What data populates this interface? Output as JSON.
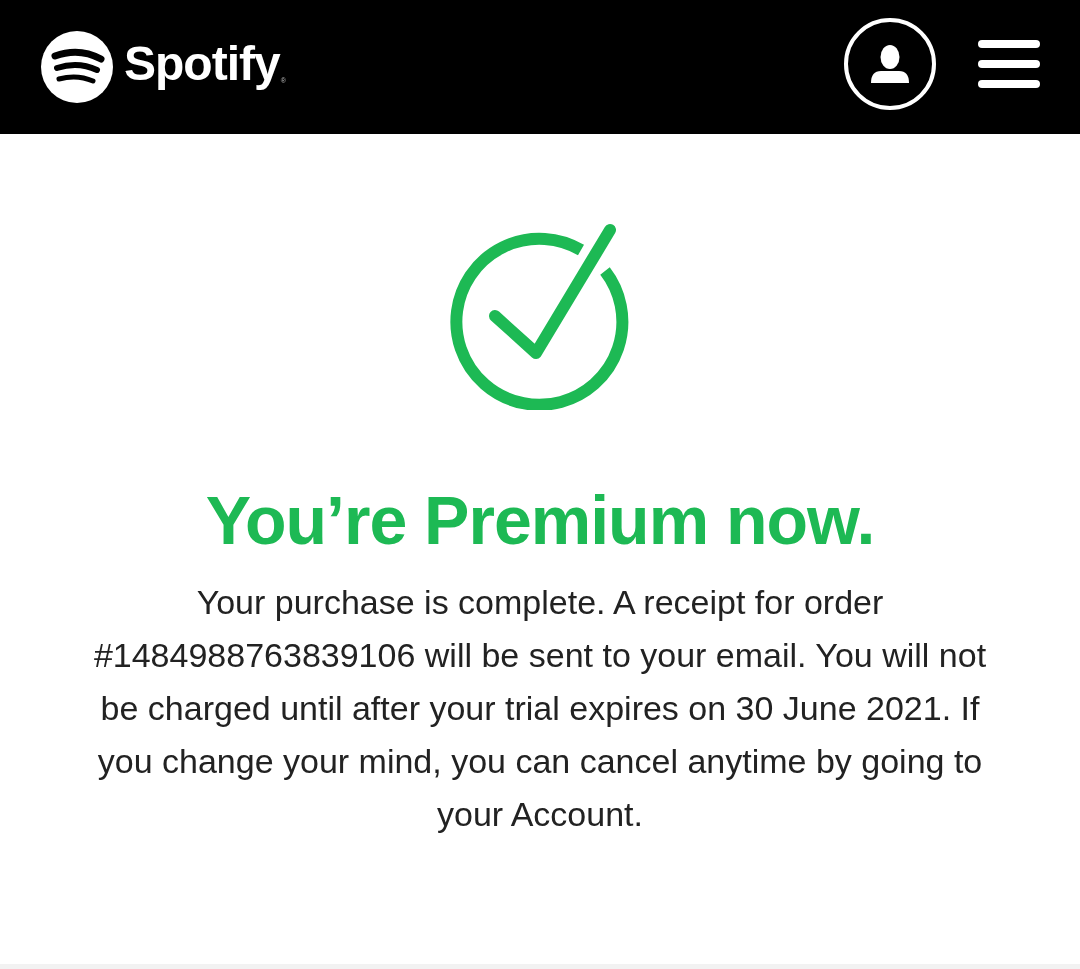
{
  "header": {
    "brand": "Spotify",
    "trademark": "®"
  },
  "confirmation": {
    "title": "You’re Premium now.",
    "message": "Your purchase is complete. A receipt for order #1484988763839106 will be sent to your email. You will not be charged until after your trial expires on 30 June 2021. If you change your mind, you can cancel anytime by going to your Account."
  }
}
